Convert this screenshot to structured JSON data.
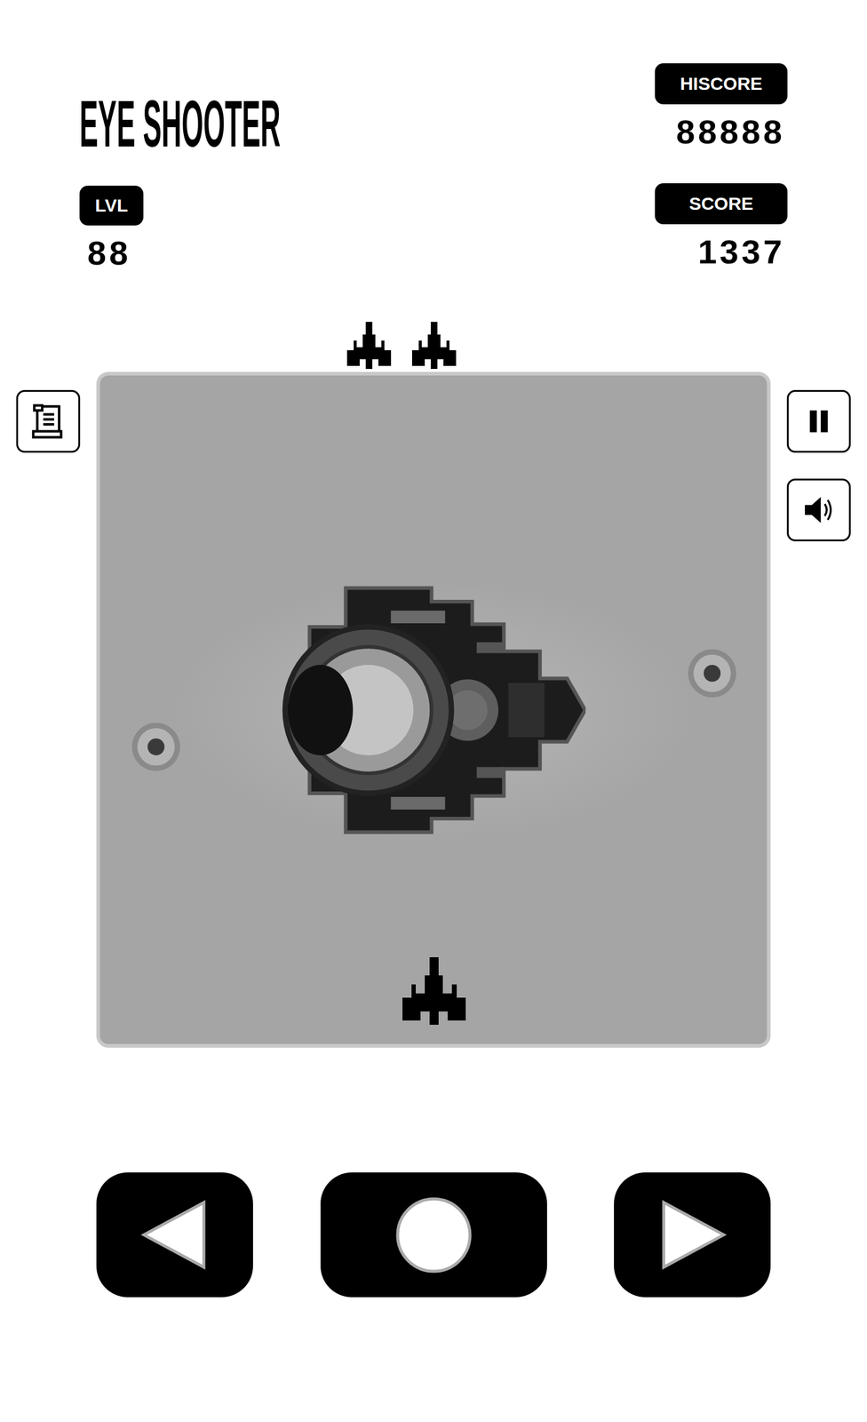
{
  "title": "EYE SHOOTER",
  "level": {
    "label": "LVL",
    "value": "88"
  },
  "hiscore": {
    "label": "HISCORE",
    "value": "88888"
  },
  "score": {
    "label": "SCORE",
    "value": "1337"
  },
  "lives": 2
}
